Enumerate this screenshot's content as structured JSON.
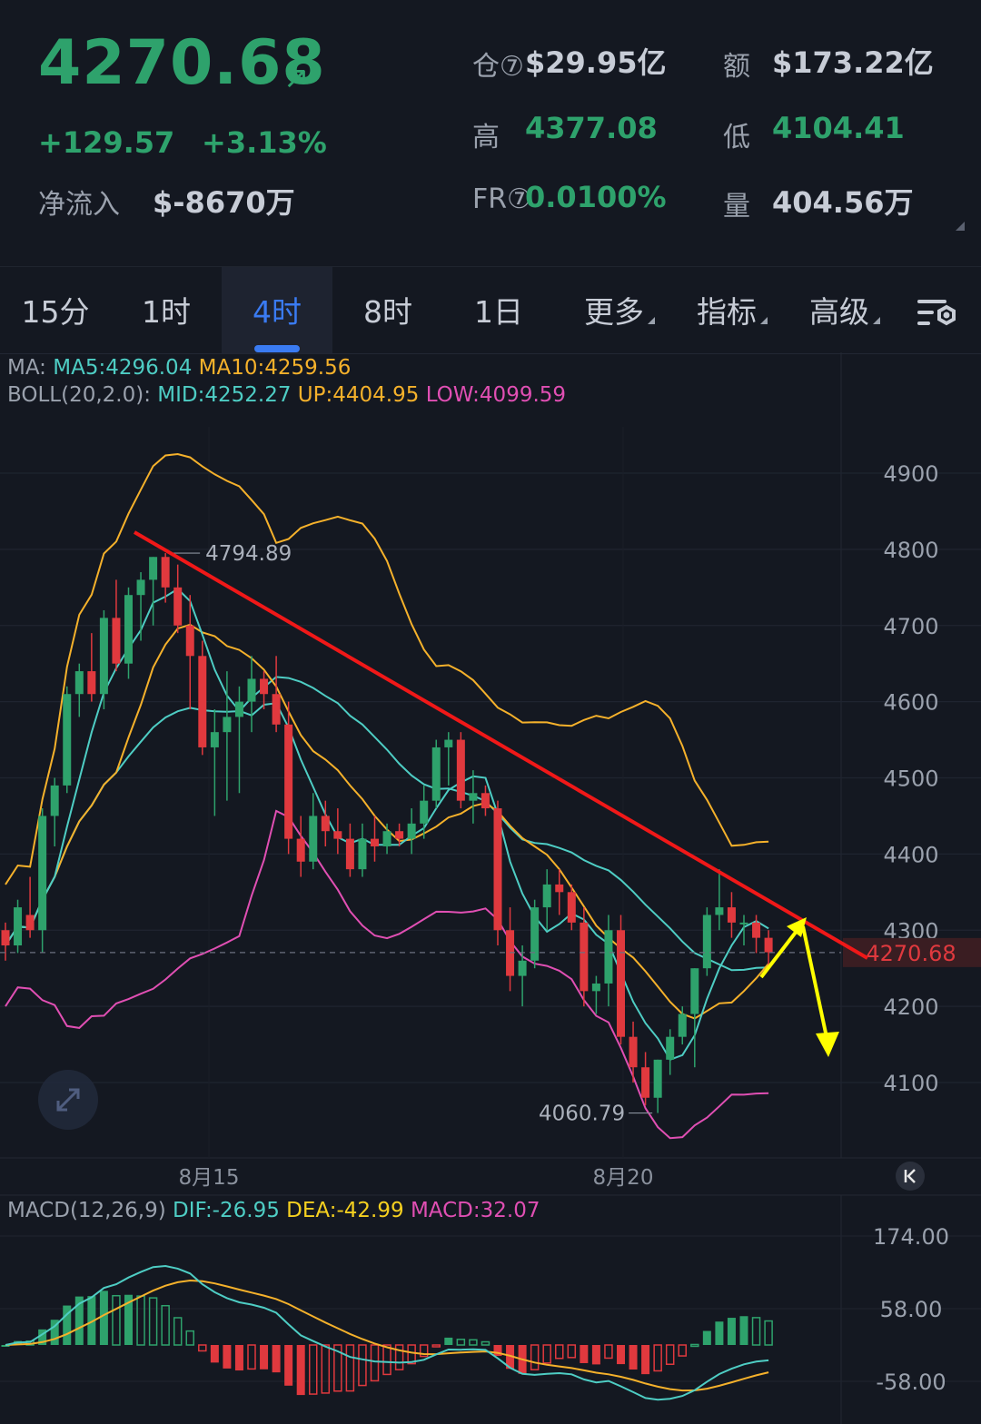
{
  "header": {
    "price": "4270.68",
    "price_arrow": "↗",
    "change_abs": "+129.57",
    "change_pct": "+3.13%",
    "netflow_label": "净流入",
    "netflow_value": "$-8670万",
    "oi_label": "仓⑦",
    "oi_value": "$29.95亿",
    "turnover_label": "额",
    "turnover_value": "$173.22亿",
    "high_label": "高",
    "high_value": "4377.08",
    "low_label": "低",
    "low_value": "4104.41",
    "fr_label": "FR⑦",
    "fr_value": "0.0100%",
    "volume_label": "量",
    "volume_value": "404.56万"
  },
  "tabs": [
    {
      "label": "15分"
    },
    {
      "label": "1时"
    },
    {
      "label": "4时",
      "active": true
    },
    {
      "label": "8时"
    },
    {
      "label": "1日"
    },
    {
      "label": "更多"
    },
    {
      "label": "指标"
    },
    {
      "label": "高级"
    }
  ],
  "indicators": {
    "ma_prefix": "MA:",
    "ma5": "MA5:4296.04",
    "ma10": "MA10:4259.56",
    "boll_prefix": "BOLL(20,2.0):",
    "boll_mid": "MID:4252.27",
    "boll_up": "UP:4404.95",
    "boll_low": "LOW:4099.59",
    "macd_prefix": "MACD(12,26,9)",
    "macd_dif": "DIF:-26.95",
    "macd_dea": "DEA:-42.99",
    "macd_val": "MACD:32.07"
  },
  "colors": {
    "up": "#2ea26c",
    "down": "#e0393e",
    "ma5": "#4ecdc4",
    "ma10": "#f5b12b",
    "boll_up": "#f5b12b",
    "boll_low": "#e04fb3",
    "boll_mid": "#4ecdc4",
    "trendline": "#f01818",
    "annotation": "#ffff00"
  },
  "chart_data": {
    "type": "candlestick",
    "price_axis": {
      "ticks": [
        "4900",
        "4800",
        "4700",
        "4600",
        "4500",
        "4400",
        "4300",
        "4200",
        "4100"
      ],
      "range": [
        4000,
        4970
      ]
    },
    "x_labels": [
      "8月15",
      "8月20"
    ],
    "current_price_label": "4270.68",
    "max_label": "4794.89",
    "min_label": "4060.79",
    "candles": [
      [
        4300,
        4310,
        4260,
        4280
      ],
      [
        4280,
        4340,
        4270,
        4330
      ],
      [
        4320,
        4370,
        4290,
        4300
      ],
      [
        4300,
        4460,
        4270,
        4450
      ],
      [
        4450,
        4500,
        4410,
        4490
      ],
      [
        4490,
        4620,
        4480,
        4610
      ],
      [
        4610,
        4650,
        4580,
        4640
      ],
      [
        4640,
        4690,
        4600,
        4610
      ],
      [
        4610,
        4720,
        4590,
        4710
      ],
      [
        4710,
        4760,
        4640,
        4650
      ],
      [
        4650,
        4750,
        4630,
        4740
      ],
      [
        4740,
        4770,
        4680,
        4760
      ],
      [
        4760,
        4790,
        4700,
        4790
      ],
      [
        4790,
        4795,
        4730,
        4750
      ],
      [
        4750,
        4780,
        4690,
        4700
      ],
      [
        4700,
        4740,
        4590,
        4660
      ],
      [
        4660,
        4680,
        4530,
        4540
      ],
      [
        4540,
        4590,
        4450,
        4560
      ],
      [
        4560,
        4640,
        4470,
        4580
      ],
      [
        4580,
        4620,
        4480,
        4600
      ],
      [
        4600,
        4660,
        4560,
        4630
      ],
      [
        4630,
        4640,
        4590,
        4610
      ],
      [
        4610,
        4660,
        4560,
        4570
      ],
      [
        4570,
        4600,
        4400,
        4420
      ],
      [
        4420,
        4450,
        4370,
        4390
      ],
      [
        4390,
        4480,
        4380,
        4450
      ],
      [
        4450,
        4470,
        4410,
        4430
      ],
      [
        4430,
        4460,
        4400,
        4420
      ],
      [
        4420,
        4440,
        4370,
        4380
      ],
      [
        4380,
        4440,
        4370,
        4420
      ],
      [
        4420,
        4450,
        4390,
        4410
      ],
      [
        4410,
        4440,
        4400,
        4430
      ],
      [
        4430,
        4440,
        4410,
        4420
      ],
      [
        4420,
        4460,
        4400,
        4440
      ],
      [
        4440,
        4490,
        4420,
        4470
      ],
      [
        4470,
        4550,
        4460,
        4540
      ],
      [
        4540,
        4560,
        4490,
        4550
      ],
      [
        4550,
        4560,
        4460,
        4470
      ],
      [
        4470,
        4510,
        4440,
        4480
      ],
      [
        4480,
        4490,
        4450,
        4460
      ],
      [
        4460,
        4470,
        4280,
        4300
      ],
      [
        4300,
        4330,
        4220,
        4240
      ],
      [
        4240,
        4280,
        4200,
        4260
      ],
      [
        4260,
        4340,
        4250,
        4330
      ],
      [
        4330,
        4380,
        4300,
        4360
      ],
      [
        4360,
        4380,
        4320,
        4350
      ],
      [
        4350,
        4360,
        4300,
        4310
      ],
      [
        4310,
        4330,
        4200,
        4220
      ],
      [
        4220,
        4240,
        4190,
        4230
      ],
      [
        4230,
        4320,
        4200,
        4300
      ],
      [
        4300,
        4320,
        4150,
        4160
      ],
      [
        4160,
        4180,
        4100,
        4120
      ],
      [
        4120,
        4140,
        4070,
        4080
      ],
      [
        4080,
        4130,
        4060,
        4130
      ],
      [
        4130,
        4170,
        4110,
        4160
      ],
      [
        4160,
        4200,
        4150,
        4190
      ],
      [
        4190,
        4250,
        4120,
        4250
      ],
      [
        4250,
        4330,
        4240,
        4320
      ],
      [
        4320,
        4380,
        4300,
        4330
      ],
      [
        4330,
        4350,
        4290,
        4310
      ],
      [
        4310,
        4320,
        4280,
        4310
      ],
      [
        4310,
        4320,
        4270,
        4290
      ],
      [
        4290,
        4300,
        4250,
        4271
      ]
    ],
    "macd_axis": {
      "ticks": [
        "174.00",
        "58.00",
        "-58.00"
      ]
    }
  }
}
